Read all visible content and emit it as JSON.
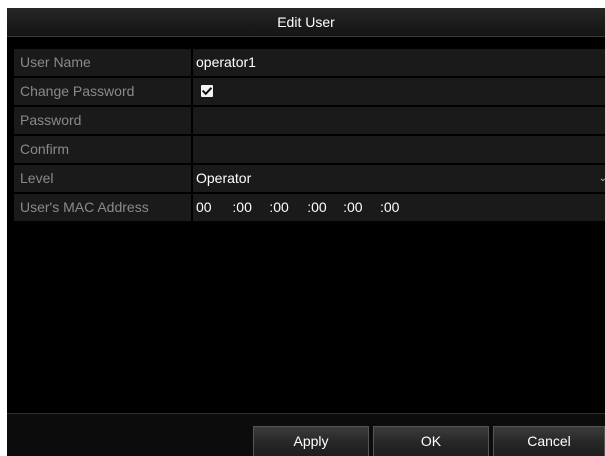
{
  "dialog": {
    "title": "Edit User"
  },
  "form": {
    "user_name_label": "User Name",
    "user_name_value": "operator1",
    "change_password_label": "Change Password",
    "change_password_checked": true,
    "password_label": "Password",
    "password_value": "",
    "confirm_label": "Confirm",
    "confirm_value": "",
    "level_label": "Level",
    "level_value": "Operator",
    "mac_label": "User's MAC Address",
    "mac_segments": [
      "00",
      ":00",
      ":00",
      ":00",
      ":00",
      ":00"
    ]
  },
  "buttons": {
    "apply": "Apply",
    "ok": "OK",
    "cancel": "Cancel"
  },
  "icons": {
    "checkbox": "checkmark-icon",
    "level_dropdown": "chevron-down-icon"
  }
}
